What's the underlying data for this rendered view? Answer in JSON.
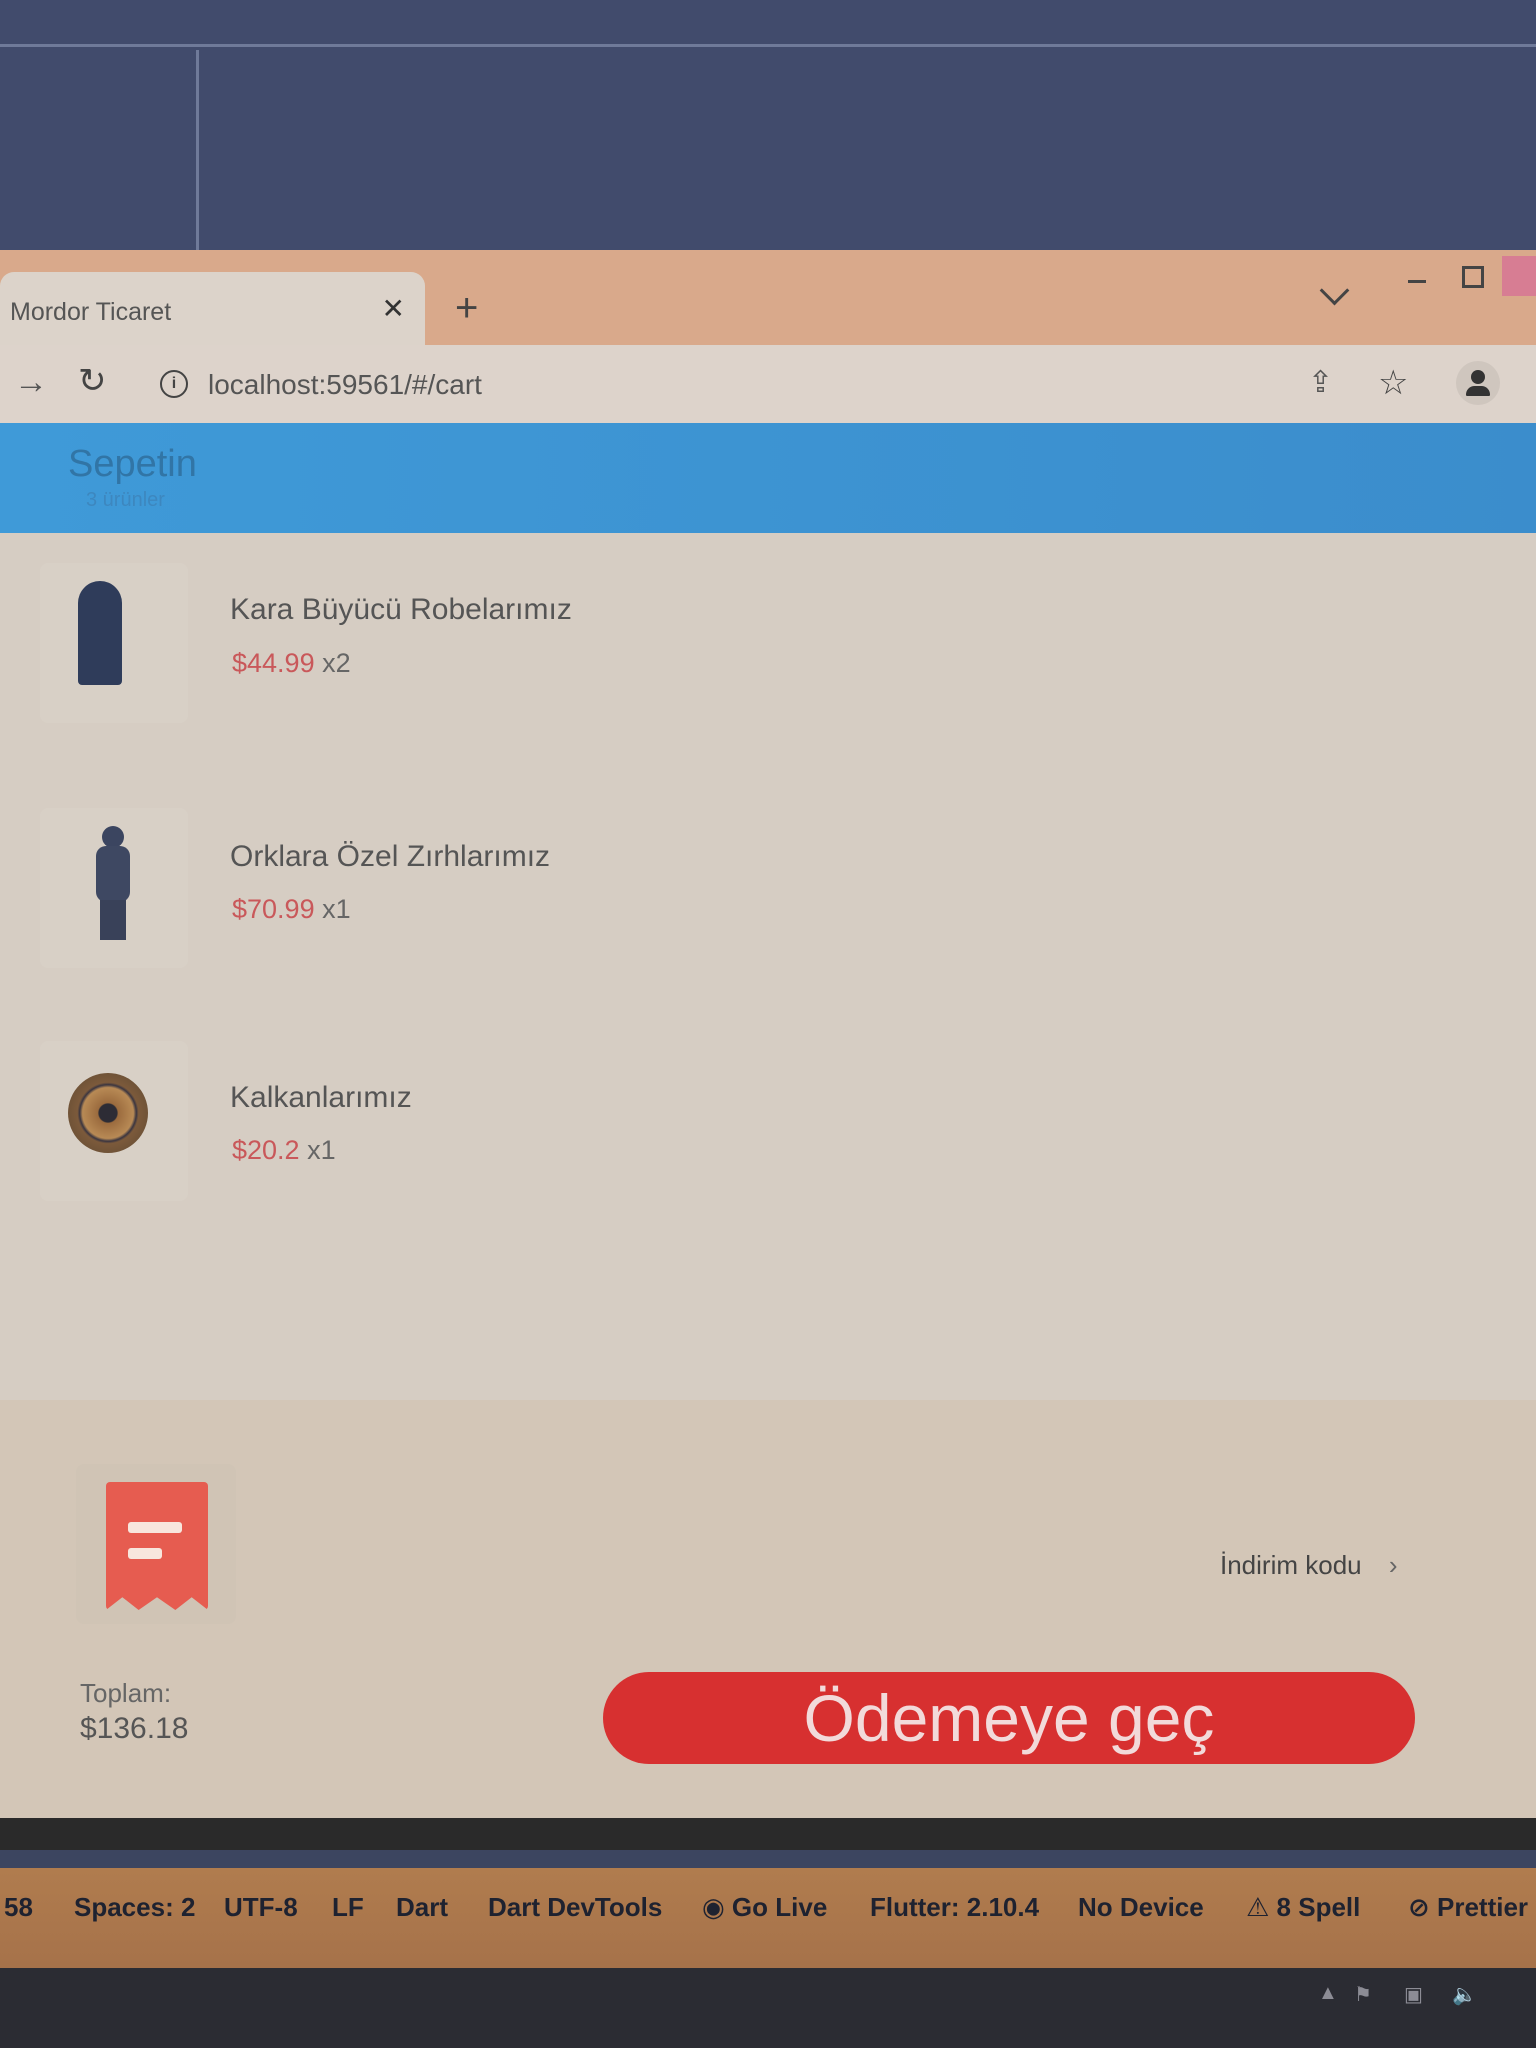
{
  "browser": {
    "tab_title": "Mordor Ticaret",
    "tab_close": "✕",
    "new_tab": "+",
    "url": "localhost:59561/#/cart"
  },
  "appbar": {
    "title": "Sepetin",
    "subtitle": "3 ürünler"
  },
  "cart": {
    "items": [
      {
        "name": "Kara Büyücü Robelarımız",
        "price": "$44.99",
        "qty": "x2",
        "image": "robe-figure"
      },
      {
        "name": "Orklara Özel Zırhlarımız",
        "price": "$70.99",
        "qty": "x1",
        "image": "orc-armor-figure"
      },
      {
        "name": "Kalkanlarımız",
        "price": "$20.2",
        "qty": "x1",
        "image": "round-shield"
      }
    ]
  },
  "checkout": {
    "discount_label": "İndirim kodu",
    "discount_chevron": "›",
    "total_label": "Toplam:",
    "total_value": "$136.18",
    "button_label": "Ödemeye geç",
    "button_color": "#d73030",
    "coupon_icon_color": "#e65c50"
  },
  "status_bar": {
    "items": [
      "58",
      "Spaces: 2",
      "UTF-8",
      "LF",
      "Dart",
      "Dart DevTools",
      "Go Live",
      "Flutter: 2.10.4",
      "No Device",
      "8 Spell",
      "Prettier"
    ]
  }
}
